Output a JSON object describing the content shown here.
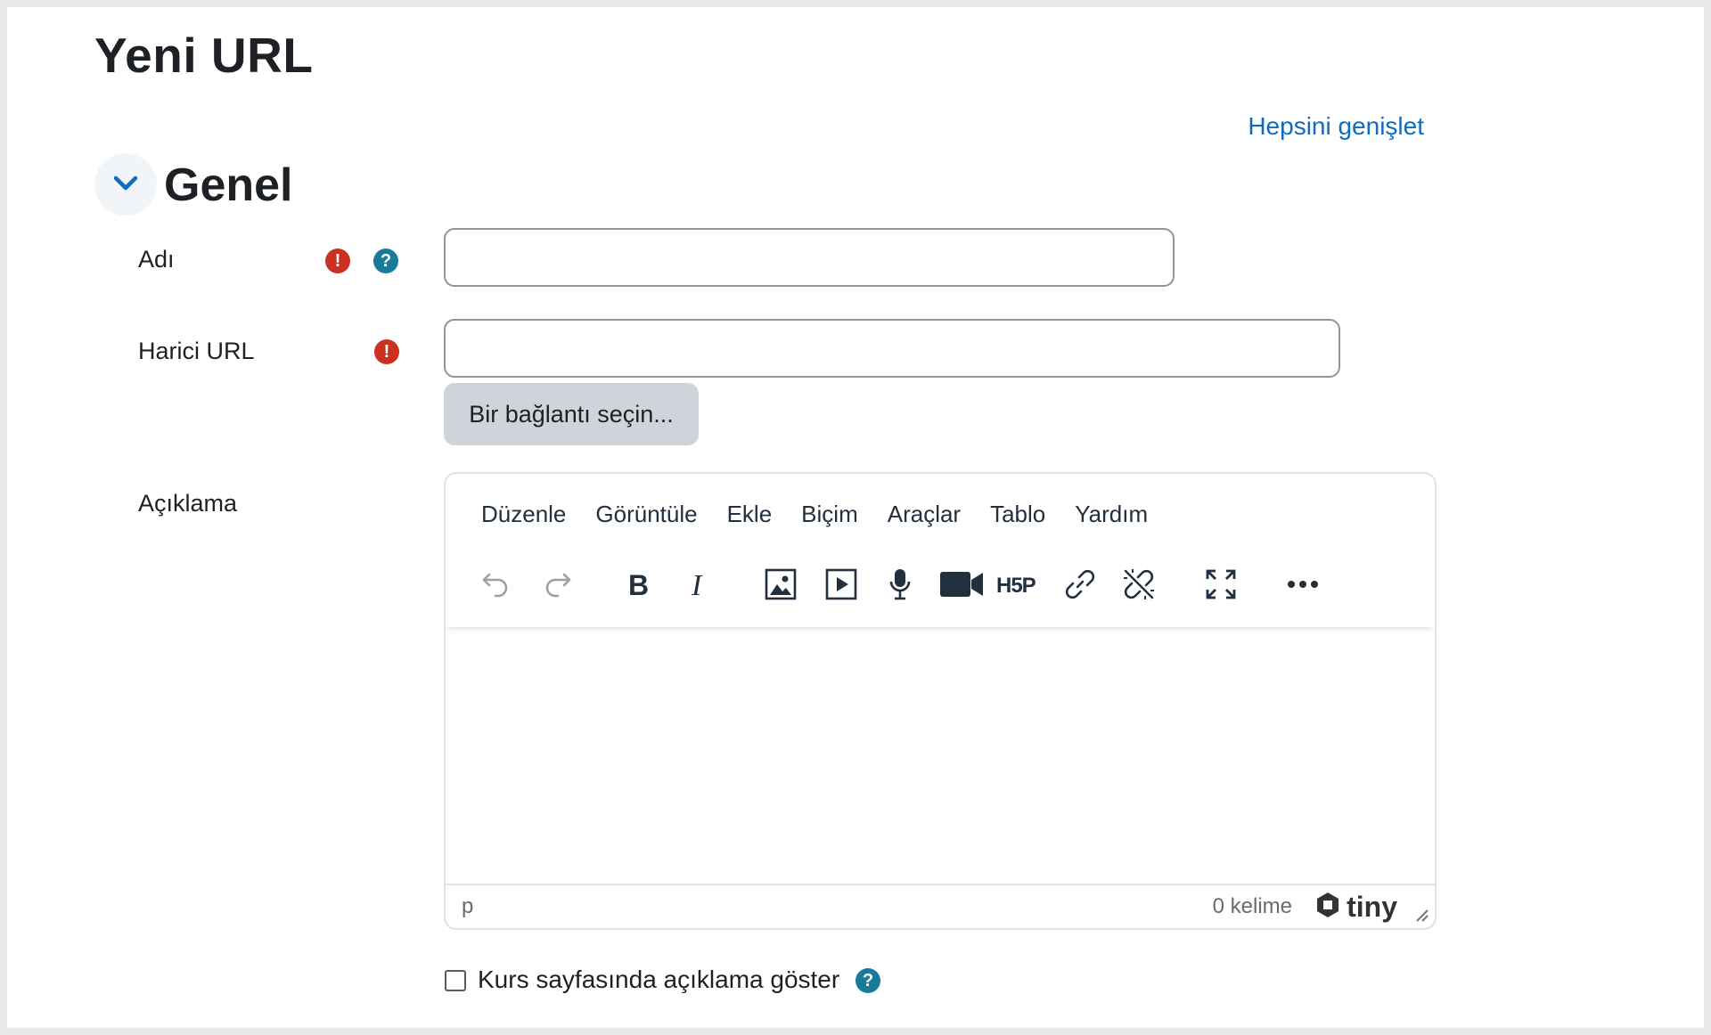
{
  "page": {
    "title": "Yeni URL",
    "expand_all": "Hepsini genişlet"
  },
  "section": {
    "title": "Genel",
    "toggle_icon": "chevron-down-icon"
  },
  "fields": {
    "name": {
      "label": "Adı",
      "value": "",
      "required_icon": "exclamation-icon",
      "help_icon": "question-icon"
    },
    "external_url": {
      "label": "Harici URL",
      "value": "",
      "required_icon": "exclamation-icon",
      "choose_link_button": "Bir bağlantı seçin..."
    },
    "description": {
      "label": "Açıklama"
    }
  },
  "editor": {
    "menus": [
      "Düzenle",
      "Görüntüle",
      "Ekle",
      "Biçim",
      "Araçlar",
      "Tablo",
      "Yardım"
    ],
    "toolbar": [
      "undo-icon",
      "redo-icon",
      "bold-icon",
      "italic-icon",
      "image-icon",
      "media-icon",
      "audio-record-icon",
      "video-record-icon",
      "h5p-icon",
      "link-icon",
      "unlink-icon",
      "fullscreen-icon",
      "more-icon"
    ],
    "content": "",
    "status_path": "p",
    "word_count": "0 kelime",
    "brand": "tiny"
  },
  "show_description": {
    "label": "Kurs sayfasında açıklama göster",
    "checked": false,
    "help_icon": "question-icon"
  },
  "colors": {
    "link": "#0f6cbf",
    "required": "#ca3120",
    "help": "#197b9a",
    "button_bg": "#ced4da"
  }
}
